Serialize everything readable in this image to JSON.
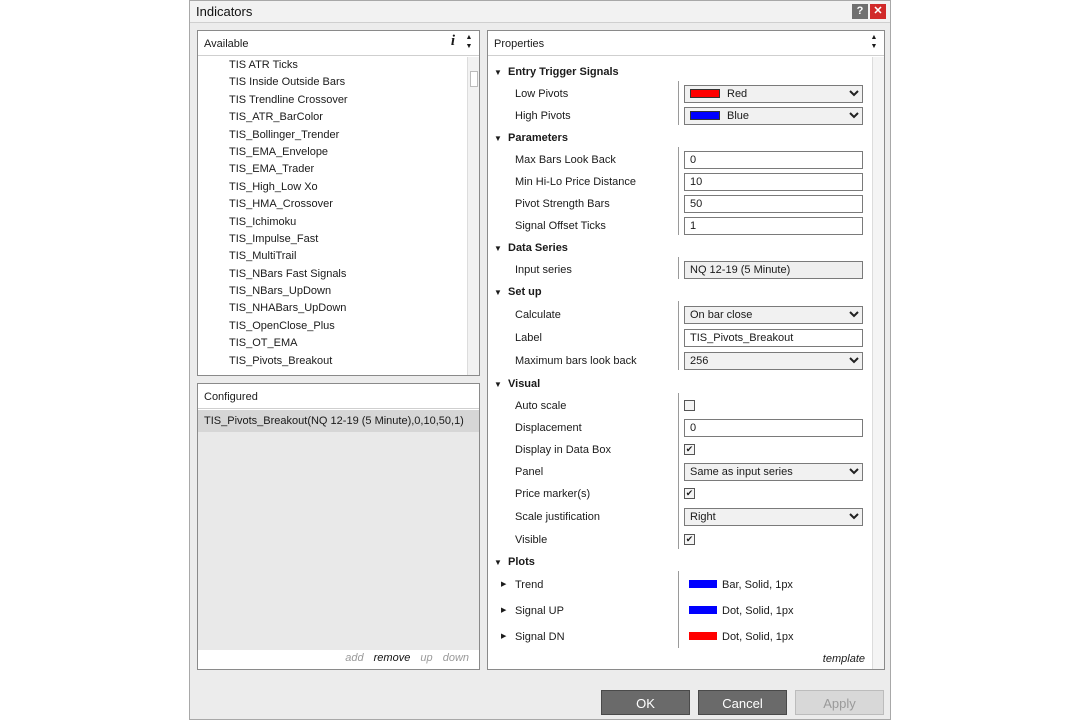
{
  "window": {
    "title": "Indicators",
    "help": "?",
    "close": "✕"
  },
  "available": {
    "header": "Available",
    "info": "i",
    "items": [
      "TIS ATR Ticks",
      "TIS Inside Outside Bars",
      "TIS Trendline Crossover",
      "TIS_ATR_BarColor",
      "TIS_Bollinger_Trender",
      "TIS_EMA_Envelope",
      "TIS_EMA_Trader",
      "TIS_High_Low Xo",
      "TIS_HMA_Crossover",
      "TIS_Ichimoku",
      "TIS_Impulse_Fast",
      "TIS_MultiTrail",
      "TIS_NBars Fast Signals",
      "TIS_NBars_UpDown",
      "TIS_NHABars_UpDown",
      "TIS_OpenClose_Plus",
      "TIS_OT_EMA",
      "TIS_Pivots_Breakout"
    ]
  },
  "configured": {
    "header": "Configured",
    "items": [
      "TIS_Pivots_Breakout(NQ 12-19 (5 Minute),0,10,50,1)"
    ],
    "actions": {
      "add": "add",
      "remove": "remove",
      "up": "up",
      "down": "down"
    }
  },
  "properties": {
    "header": "Properties",
    "template": "template",
    "entry": {
      "label": "Entry Trigger Signals",
      "low_label": "Low Pivots",
      "low_value": "Red",
      "low_color": "#ff0000",
      "high_label": "High Pivots",
      "high_value": "Blue",
      "high_color": "#0000ff"
    },
    "parameters": {
      "label": "Parameters",
      "max_bars_label": "Max Bars Look Back",
      "max_bars": "0",
      "min_hilo_label": "Min Hi-Lo Price Distance",
      "min_hilo": "10",
      "pivot_label": "Pivot Strength Bars",
      "pivot": "50",
      "offset_label": "Signal Offset Ticks",
      "offset": "1"
    },
    "data_series": {
      "label": "Data Series",
      "input_label": "Input series",
      "input": "NQ 12-19 (5 Minute)"
    },
    "setup": {
      "label": "Set up",
      "calculate_label": "Calculate",
      "calculate": "On bar close",
      "label_label": "Label",
      "label_value": "TIS_Pivots_Breakout",
      "max_lookback_label": "Maximum bars look back",
      "max_lookback": "256"
    },
    "visual": {
      "label": "Visual",
      "auto_scale_label": "Auto scale",
      "displacement_label": "Displacement",
      "displacement": "0",
      "databox_label": "Display in Data Box",
      "panel_label": "Panel",
      "panel": "Same as input series",
      "price_marker_label": "Price marker(s)",
      "scale_just_label": "Scale justification",
      "scale_just": "Right",
      "visible_label": "Visible"
    },
    "plots": {
      "label": "Plots",
      "items": [
        {
          "name": "Trend",
          "value": "Bar, Solid, 1px",
          "color": "#0000ff"
        },
        {
          "name": "Signal UP",
          "value": "Dot, Solid, 1px",
          "color": "#0000ff"
        },
        {
          "name": "Signal DN",
          "value": "Dot, Solid, 1px",
          "color": "#ff0000"
        }
      ]
    }
  },
  "checks": {
    "auto_scale": false,
    "databox": true,
    "price_marker": true,
    "visible": true
  },
  "buttons": {
    "ok": "OK",
    "cancel": "Cancel",
    "apply": "Apply"
  }
}
